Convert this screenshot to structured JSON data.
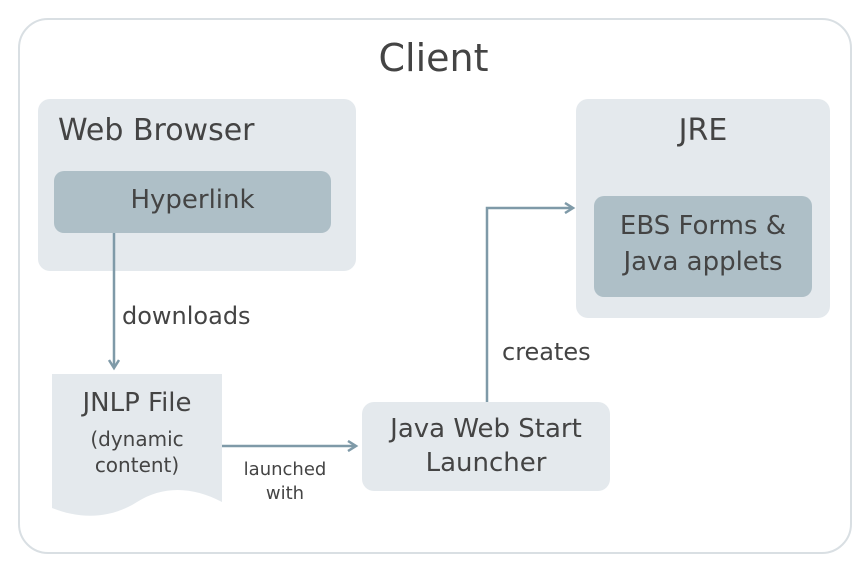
{
  "diagram": {
    "client_title": "Client",
    "web_browser": {
      "label": "Web Browser",
      "hyperlink": "Hyperlink"
    },
    "jre": {
      "label": "JRE",
      "ebs_line1": "EBS Forms &",
      "ebs_line2": "Java applets"
    },
    "jnlp": {
      "title": "JNLP File",
      "sub_line1": "(dynamic",
      "sub_line2": "content)"
    },
    "launcher": {
      "line1": "Java Web Start",
      "line2": "Launcher"
    },
    "edges": {
      "downloads": "downloads",
      "launched_line1": "launched",
      "launched_line2": "with",
      "creates": "creates"
    },
    "colors": {
      "outer_box": "#e4e9ed",
      "inner_box": "#aebfc7",
      "arrow": "#7f9aa8",
      "frame_border": "#d9dfe3"
    }
  }
}
